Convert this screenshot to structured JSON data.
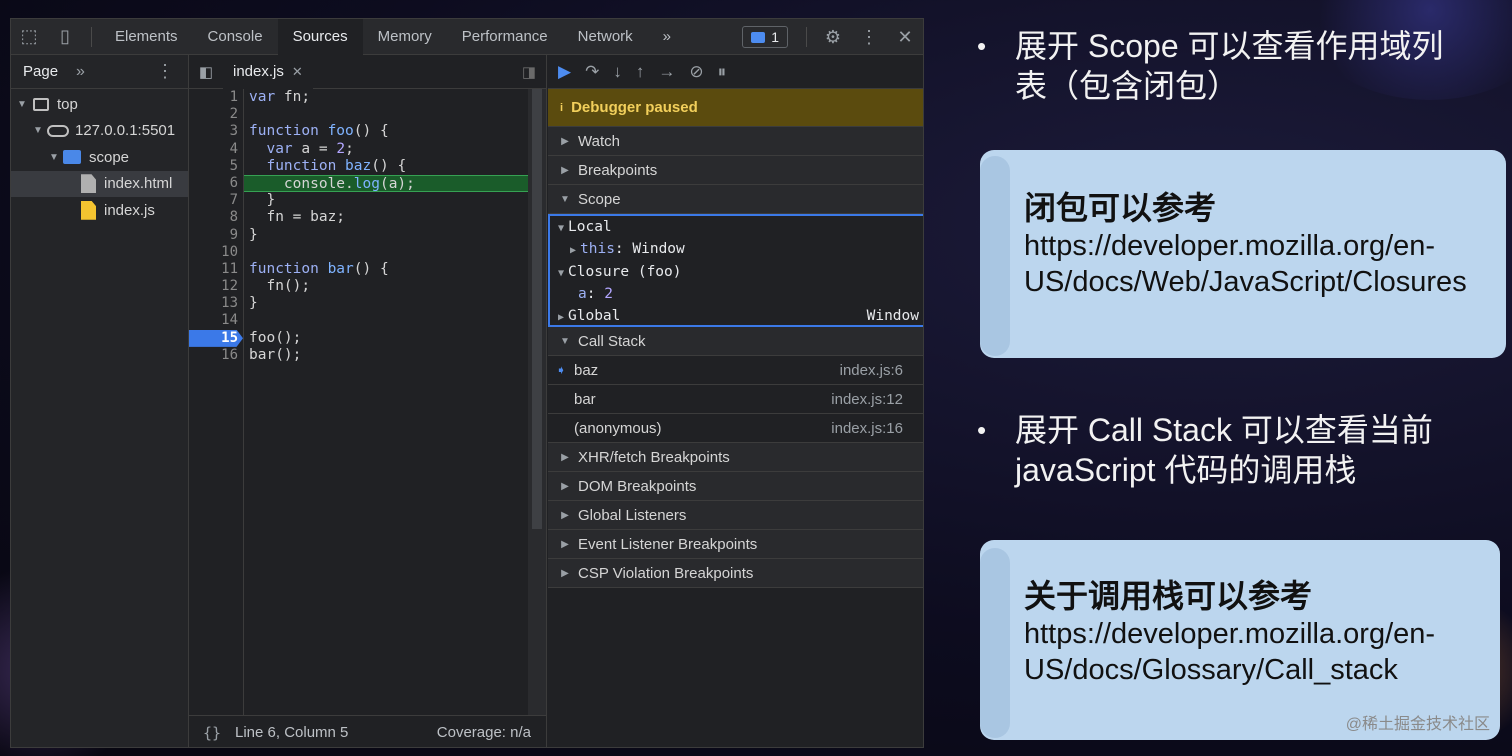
{
  "devtools": {
    "tabs": [
      "Elements",
      "Console",
      "Sources",
      "Memory",
      "Performance",
      "Network"
    ],
    "active_tab": "Sources",
    "overflow_label": "»",
    "message_count": "1",
    "navigator": {
      "tab_label": "Page",
      "more_label": "»",
      "tree": [
        {
          "label": "top",
          "icon": "frame-icon",
          "indent": 0
        },
        {
          "label": "127.0.0.1:5501",
          "icon": "cloud-icon",
          "indent": 1
        },
        {
          "label": "scope",
          "icon": "folder-icon",
          "indent": 2
        },
        {
          "label": "index.html",
          "icon": "file-icon",
          "indent": 3,
          "selected": true
        },
        {
          "label": "index.js",
          "icon": "js-file-icon",
          "indent": 3
        }
      ]
    },
    "editor": {
      "file_tab": "index.js",
      "line_numbers": [
        "1",
        "2",
        "3",
        "4",
        "5",
        "6",
        "7",
        "8",
        "9",
        "10",
        "11",
        "12",
        "13",
        "14",
        "15",
        "16"
      ],
      "breakpoint_line": "15",
      "status_braces": "{}",
      "status_position": "Line 6, Column 5",
      "status_coverage": "Coverage: n/a"
    },
    "debugger": {
      "paused_label": "Debugger paused",
      "info_glyph": "i",
      "panes": {
        "watch": "Watch",
        "breakpoints": "Breakpoints",
        "scope": "Scope",
        "call_stack": "Call Stack",
        "xhr": "XHR/fetch Breakpoints",
        "dom": "DOM Breakpoints",
        "global_listeners": "Global Listeners",
        "event_listeners": "Event Listener Breakpoints",
        "csp": "CSP Violation Breakpoints"
      },
      "scope": {
        "local_label": "Local",
        "this_key": "this",
        "this_value": ": Window",
        "closure_label": "Closure (foo)",
        "a_key": "a",
        "a_value": "2",
        "global_label": "Global",
        "global_value": "Window"
      },
      "call_stack": [
        {
          "name": "baz",
          "location": "index.js:6",
          "current": true
        },
        {
          "name": "bar",
          "location": "index.js:12"
        },
        {
          "name": "(anonymous)",
          "location": "index.js:16"
        }
      ]
    }
  },
  "slide": {
    "bullet1": "展开 Scope 可以查看作用域列表（包含闭包）",
    "card1_title": "闭包可以参考",
    "card1_line1": "https://developer.mozilla.org/en-",
    "card1_line2": "US/docs/Web/JavaScript/Closures",
    "bullet2": "展开 Call Stack 可以查看当前javaScript 代码的调用栈",
    "card2_title": "关于调用栈可以参考",
    "card2_line1": "https://developer.mozilla.org/en-",
    "card2_line2": "US/docs/Glossary/Call_stack",
    "bullet_glyph": "•",
    "watermark": "@稀土掘金技术社区"
  },
  "colors": {
    "accent_blue": "#3b79e8",
    "paused_banner": "#5b4b0e",
    "exec_line": "#1a5c2a",
    "card_bg": "#bcd6ee"
  }
}
